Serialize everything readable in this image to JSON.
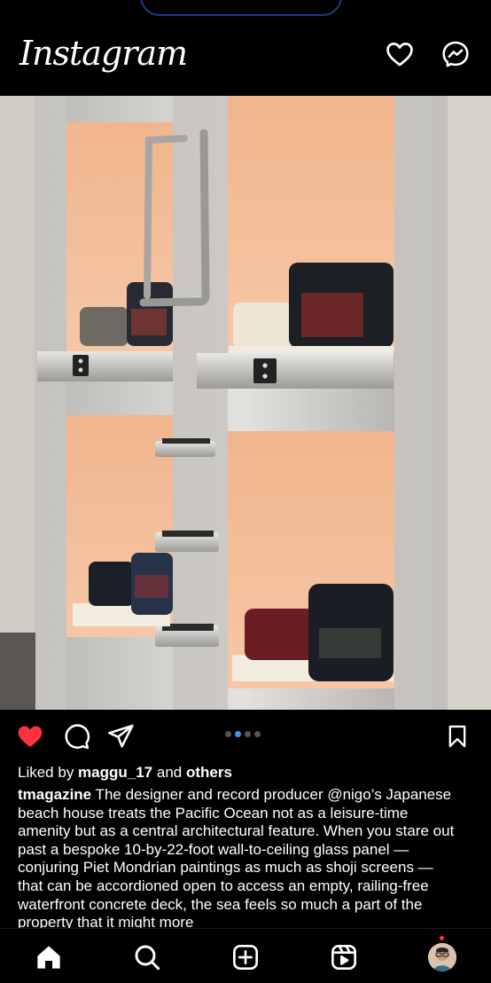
{
  "app": {
    "logo": "Instagram"
  },
  "header": {
    "icons": [
      "heart-icon",
      "messenger-icon"
    ]
  },
  "post": {
    "carousel": {
      "total": 4,
      "active_index": 1
    },
    "liked": true,
    "likes_prefix": "Liked by ",
    "liked_by_user": "maggu_17",
    "likes_middle": " and ",
    "likes_others": "others",
    "author": "tmagazine",
    "caption_text": " The designer and record producer @nigo’s Japanese beach house treats the Pacific Ocean not as a leisure-time amenity but as a central architectural feature. When you stare out past a bespoke 10-by-22-foot wall-to-ceiling glass panel — conjuring Piet Mondrian paintings as much as shoji screens — that can be accordioned open to access an empty, railing-free waterfront concrete deck, the sea feels so much a part of the property that it might more"
  },
  "tabbar": {
    "items": [
      "home-icon",
      "search-icon",
      "create-icon",
      "reels-icon",
      "profile-avatar"
    ]
  },
  "colors": {
    "like": "#ff3040",
    "active_dot": "#3897f0",
    "background": "#000000"
  }
}
